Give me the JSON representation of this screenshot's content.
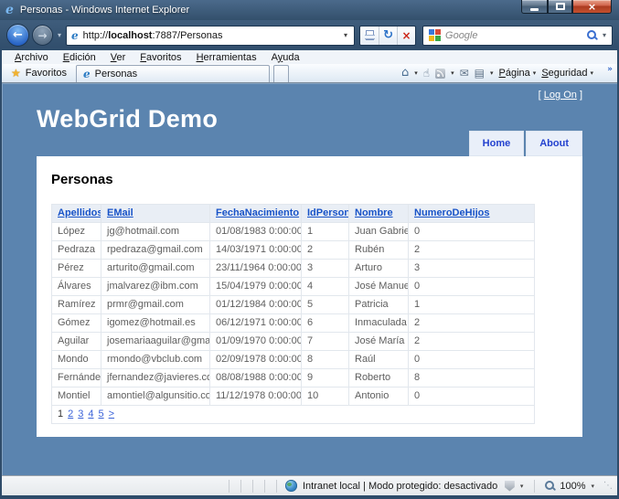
{
  "window": {
    "title": "Personas - Windows Internet Explorer"
  },
  "navband": {
    "url_prefix": "http://",
    "url_host": "localhost",
    "url_suffix": ":7887/Personas",
    "search_placeholder": "Google"
  },
  "menubar": {
    "items": [
      {
        "label": "Archivo",
        "accel": "A"
      },
      {
        "label": "Edición",
        "accel": "E"
      },
      {
        "label": "Ver",
        "accel": "V"
      },
      {
        "label": "Favoritos",
        "accel": "F"
      },
      {
        "label": "Herramientas",
        "accel": "H"
      },
      {
        "label": "Ayuda",
        "accel": "y"
      }
    ]
  },
  "cmdbar": {
    "favorites_label": "Favoritos",
    "tab_label": "Personas",
    "page_label": "Página",
    "page_accel": "P",
    "safety_label": "Seguridad",
    "safety_accel": "S"
  },
  "page": {
    "logon": {
      "open": "[",
      "label": "Log On",
      "close": "]"
    },
    "title": "WebGrid Demo",
    "nav_home": "Home",
    "nav_about": "About",
    "heading": "Personas",
    "table": {
      "headers": [
        "Apellidos",
        "EMail",
        "FechaNacimiento",
        "IdPersona",
        "Nombre",
        "NumeroDeHijos"
      ],
      "rows": [
        [
          "López",
          "jg@hotmail.com",
          "01/08/1983 0:00:00",
          "1",
          "Juan Gabriel",
          "0"
        ],
        [
          "Pedraza",
          "rpedraza@gmail.com",
          "14/03/1971 0:00:00",
          "2",
          "Rubén",
          "2"
        ],
        [
          "Pérez",
          "arturito@gmail.com",
          "23/11/1964 0:00:00",
          "3",
          "Arturo",
          "3"
        ],
        [
          "Álvares",
          "jmalvarez@ibm.com",
          "15/04/1979 0:00:00",
          "4",
          "José Manuel",
          "0"
        ],
        [
          "Ramírez",
          "prmr@gmail.com",
          "01/12/1984 0:00:00",
          "5",
          "Patricia",
          "1"
        ],
        [
          "Gómez",
          "igomez@hotmail.es",
          "06/12/1971 0:00:00",
          "6",
          "Inmaculada",
          "2"
        ],
        [
          "Aguilar",
          "josemariaaguilar@gmail.com",
          "01/09/1970 0:00:00",
          "7",
          "José María",
          "2"
        ],
        [
          "Mondo",
          "rmondo@vbclub.com",
          "02/09/1978 0:00:00",
          "8",
          "Raúl",
          "0"
        ],
        [
          "Fernández",
          "jfernandez@javieres.com",
          "08/08/1988 0:00:00",
          "9",
          "Roberto",
          "8"
        ],
        [
          "Montiel",
          "amontiel@algunsitio.com",
          "11/12/1978 0:00:00",
          "10",
          "Antonio",
          "0"
        ]
      ]
    },
    "pagination": {
      "current": "1",
      "links": [
        "2",
        "3",
        "4",
        "5",
        ">"
      ]
    }
  },
  "statusbar": {
    "text": "Intranet local | Modo protegido: desactivado",
    "zoom_level": "100%"
  },
  "icons": {
    "ie": "e",
    "back": "←",
    "forward": "→",
    "dropdown": "▾",
    "refresh": "↻",
    "stop": "×",
    "close": "×",
    "star": "★",
    "home": "⌂",
    "hand": "☝",
    "mail": "✉",
    "print": "▤",
    "chevron": "»",
    "grip": "⋱"
  },
  "colors": {
    "page_bg": "#5b84af",
    "panel_bg": "#ffffff",
    "titlebar_top": "#4b6a8b",
    "titlebar_bottom": "#33506c",
    "header_link": "#1853c8",
    "nav_button_bg": "#e9eff9",
    "nav_button_text": "#2442cf",
    "table_header_bg": "#e9eef5",
    "cell_text": "#5e5e5e",
    "star": "#f2b22e"
  }
}
